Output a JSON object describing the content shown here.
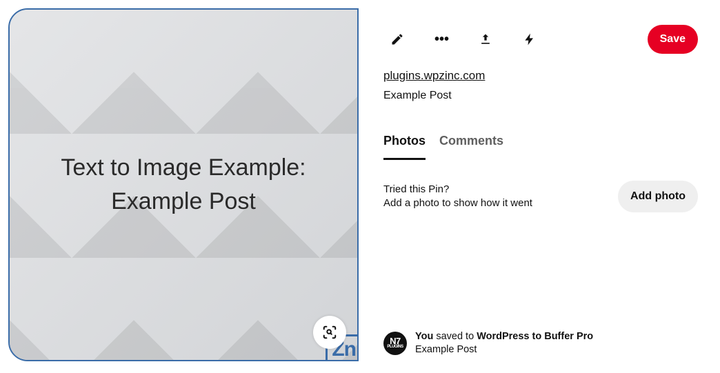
{
  "image": {
    "text_line1": "Text to Image Example:",
    "text_line2": "Example Post",
    "watermark": "Zn"
  },
  "toolbar": {
    "save_label": "Save"
  },
  "source": {
    "url_label": "plugins.wpzinc.com",
    "title": "Example Post"
  },
  "tabs": {
    "photos": "Photos",
    "comments": "Comments"
  },
  "tried": {
    "line1": "Tried this Pin?",
    "line2": "Add a photo to show how it went",
    "button": "Add photo"
  },
  "attribution": {
    "prefix_bold": "You",
    "middle": " saved to ",
    "board_bold": "WordPress to Buffer Pro",
    "subtitle": "Example Post",
    "avatar_label": "N7"
  }
}
